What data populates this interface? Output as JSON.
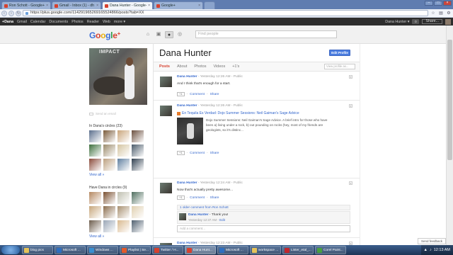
{
  "browser": {
    "tabs": [
      {
        "label": "Ron Schott - Google+",
        "color": "#d6412f",
        "active": false
      },
      {
        "label": "Gmail - Inbox (1) - dh",
        "color": "#d6412f",
        "active": false
      },
      {
        "label": "Dana Hunter - Google+",
        "color": "#d6412f",
        "active": true
      },
      {
        "label": "Google+",
        "color": "#d6412f",
        "active": false
      }
    ],
    "url": "https://plus.google.com/114291965269165524866/posts?tab=XX"
  },
  "gbar": {
    "items": [
      "+Dana",
      "Gmail",
      "Calendar",
      "Documents",
      "Photos",
      "Reader",
      "Web",
      "more ▾"
    ],
    "user": "Dana Hunter ▾",
    "notifications": "0",
    "share": "Share..."
  },
  "header": {
    "search_placeholder": "Find people"
  },
  "profile": {
    "name": "Dana Hunter",
    "edit_label": "Edit Profile",
    "photo_sign": "IMPACT",
    "send_message": "Send an email",
    "in_circles_label": "In Dana's circles (23)",
    "have_in_circles_label": "Have Dana in circles (9)",
    "view_all": "View all »",
    "circle_colors_a": [
      "#5a6e8c",
      "#7a5a3a",
      "#c9a47a",
      "#6b4f3f",
      "#3d6f3d",
      "#9a8a6a",
      "#d4c4a0",
      "#4a5a6a",
      "#8a4a3a",
      "#bca080",
      "#5f7f9f",
      "#2f3f4f"
    ],
    "circle_colors_b": [
      "#b58860",
      "#7a4f2f",
      "#c0c0b0",
      "#4f6f5f",
      "#c7a67b",
      "#8b6d4d",
      "#a89070",
      "#e0d0b0",
      "#6c5c4c",
      "#9aa6b6",
      "#d9b98f",
      "#506070"
    ]
  },
  "tabs": {
    "items": [
      "Posts",
      "About",
      "Photos",
      "Videos",
      "+1's"
    ],
    "search_placeholder": "View profile as..."
  },
  "posts": [
    {
      "author": "Dana Hunter",
      "time": "Yesterday 12:26 AM",
      "visibility": "Public",
      "text": "And I think that's enough for a start."
    },
    {
      "author": "Dana Hunter",
      "time": "Yesterday 12:26 AM",
      "visibility": "Public",
      "link_title": "En Tequila Es Verdad: Dojo Summer Sessions: Neil Gaiman's Sage Advice",
      "desc": "Dojo Summer Sessions: Neil Gaiman's Sage Advice. A brief intro for those who have been a) living under a rock, b) out pounding on rocks (hey, most of my friends are geologists, so it's distinc..."
    },
    {
      "author": "Dana Hunter",
      "time": "Yesterday 12:24 AM",
      "visibility": "Public",
      "text": "Now that's actually pretty awesome...",
      "older": "1 older comment from Ron Schott",
      "comment_author": "Dana Hunter",
      "comment_text": "- Thank you!",
      "comment_time": "Yesterday 12:37 AM",
      "comment_edit": "Edit",
      "add_comment": "Add a comment..."
    },
    {
      "author": "Dana Hunter",
      "time": "Yesterday 12:23 AM",
      "visibility": "Public"
    }
  ],
  "actions": {
    "plus": "+1",
    "comment": "Comment",
    "share": "Share",
    "sep_dot": "·",
    "sep_dash": "-"
  },
  "feedback": "Send feedback",
  "taskbar": {
    "items": [
      {
        "label": "blog pics",
        "color": "#e6c35a"
      },
      {
        "label": "Microsoft ...",
        "color": "#2f6fc0"
      },
      {
        "label": "Windows ...",
        "color": "#3a8fd0"
      },
      {
        "label": "Playlist | Se...",
        "color": "#e35a2a"
      },
      {
        "label": "Twitter / H...",
        "color": "#d6412f"
      },
      {
        "label": "Dana Hunt...",
        "color": "#d6412f"
      },
      {
        "label": "Microsoft ...",
        "color": "#2f6fc0"
      },
      {
        "label": "workspace ...",
        "color": "#e6c35a"
      },
      {
        "label": "Lister_etal_...",
        "color": "#c0262d"
      },
      {
        "label": "Corel Paint...",
        "color": "#4aa040"
      }
    ],
    "time": "12:13 AM"
  }
}
